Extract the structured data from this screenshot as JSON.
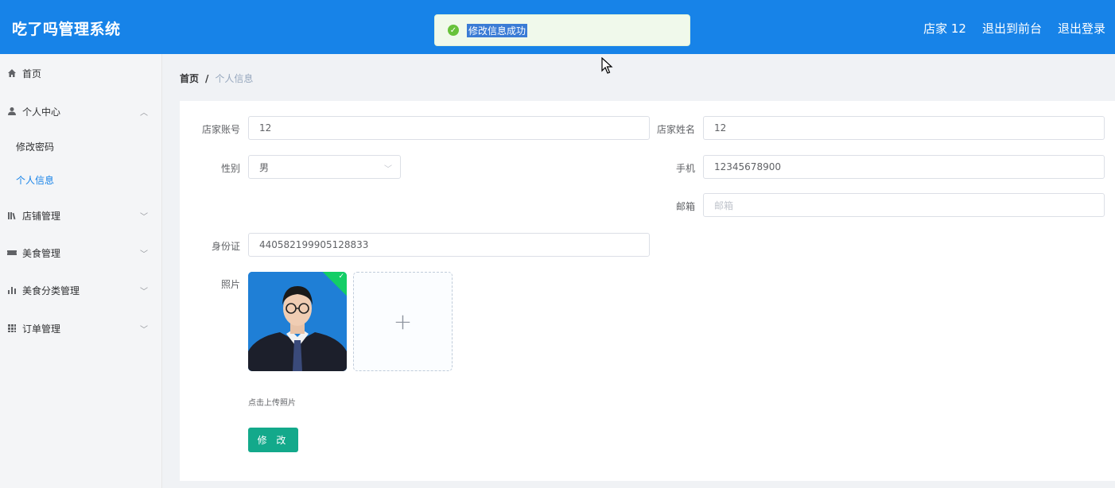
{
  "header": {
    "title": "吃了吗管理系统",
    "user": "店家 12",
    "back_front": "退出到前台",
    "logout": "退出登录"
  },
  "toast": {
    "message": "修改信息成功",
    "type": "success"
  },
  "sidebar": {
    "items": [
      {
        "label": "首页",
        "icon": "home-icon"
      },
      {
        "label": "个人中心",
        "icon": "user-icon",
        "expanded": true
      },
      {
        "label": "修改密码"
      },
      {
        "label": "个人信息",
        "active": true
      },
      {
        "label": "店铺管理",
        "icon": "library-icon"
      },
      {
        "label": "美食管理",
        "icon": "ticket-icon"
      },
      {
        "label": "美食分类管理",
        "icon": "bar-chart-icon"
      },
      {
        "label": "订单管理",
        "icon": "grid-icon"
      }
    ]
  },
  "breadcrumb": {
    "home": "首页",
    "separator": "/",
    "current": "个人信息"
  },
  "form": {
    "account_label": "店家账号",
    "account_value": "12",
    "name_label": "店家姓名",
    "name_value": "12",
    "gender_label": "性别",
    "gender_value": "男",
    "phone_label": "手机",
    "phone_value": "12345678900",
    "email_label": "邮箱",
    "email_placeholder": "邮箱",
    "idcard_label": "身份证",
    "idcard_value": "440582199905128833",
    "photo_label": "照片",
    "upload_hint": "点击上传照片",
    "upload_plus": "+",
    "submit_label": "修 改"
  },
  "colors": {
    "primary": "#1783e8",
    "success": "#67c23a",
    "button": "#13a98b"
  }
}
